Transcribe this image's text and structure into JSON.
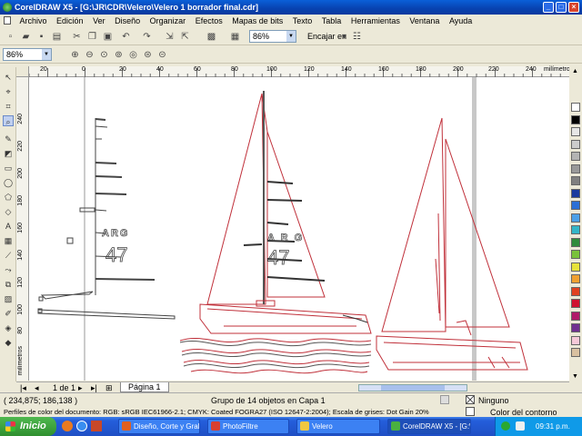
{
  "window": {
    "title": "CorelDRAW X5 - [G:\\JR\\CDR\\Velero\\Velero 1 borrador final.cdr]"
  },
  "menu": [
    "Archivo",
    "Edición",
    "Ver",
    "Diseño",
    "Organizar",
    "Efectos",
    "Mapas de bits",
    "Texto",
    "Tabla",
    "Herramientas",
    "Ventana",
    "Ayuda"
  ],
  "toolbar": {
    "zoom_value": "86%",
    "snap_label": "Encajar en"
  },
  "propbar": {
    "zoom_value": "86%"
  },
  "ruler": {
    "unit": "milímetros",
    "h_labels": [
      "20",
      "0",
      "20",
      "40",
      "60",
      "80",
      "100",
      "120",
      "140",
      "160",
      "180",
      "200",
      "220",
      "240"
    ],
    "v_labels": [
      "240",
      "220",
      "200",
      "180",
      "160",
      "140",
      "120",
      "100",
      "80",
      "60",
      "40",
      "20"
    ],
    "v_unit": "milímetros"
  },
  "canvas": {
    "sail_text_1": "ARG",
    "sail_number_1": "47",
    "sail_text_2": "A R G",
    "sail_number_2": "47"
  },
  "navigator": {
    "page_count": "1 de 1",
    "page_tab": "Página 1"
  },
  "status": {
    "coords": "( 234,875; 186,138 )",
    "selection": "Grupo de 14 objetos en Capa 1",
    "color_profiles": "Perfiles de color del documento: RGB: sRGB IEC61966-2.1; CMYK: Coated FOGRA27 (ISO 12647-2:2004); Escala de grises: Dot Gain 20%",
    "fill": "Ninguno",
    "outline": "Color del contorno"
  },
  "taskbar": {
    "start": "Inicio",
    "tasks": [
      "Diseño, Corte y Grab...",
      "PhotoFiltre",
      "Velero",
      "CorelDRAW X5 - [G:\\..."
    ],
    "clock": "09:31 p.m."
  },
  "colors": {
    "titlebar": "#0842b0",
    "palette": [
      "#ffffff",
      "#000000",
      "#e6e6e6",
      "#cccccc",
      "#b3b3b3",
      "#999999",
      "#808080",
      "#1a3a9e",
      "#2b6fd6",
      "#4aa0e8",
      "#33b5c8",
      "#2e8b3a",
      "#79c23a",
      "#e7e23a",
      "#f0a030",
      "#e04020",
      "#d01030",
      "#b01868",
      "#703090",
      "#f6c9d8",
      "#d8c0a0"
    ]
  }
}
